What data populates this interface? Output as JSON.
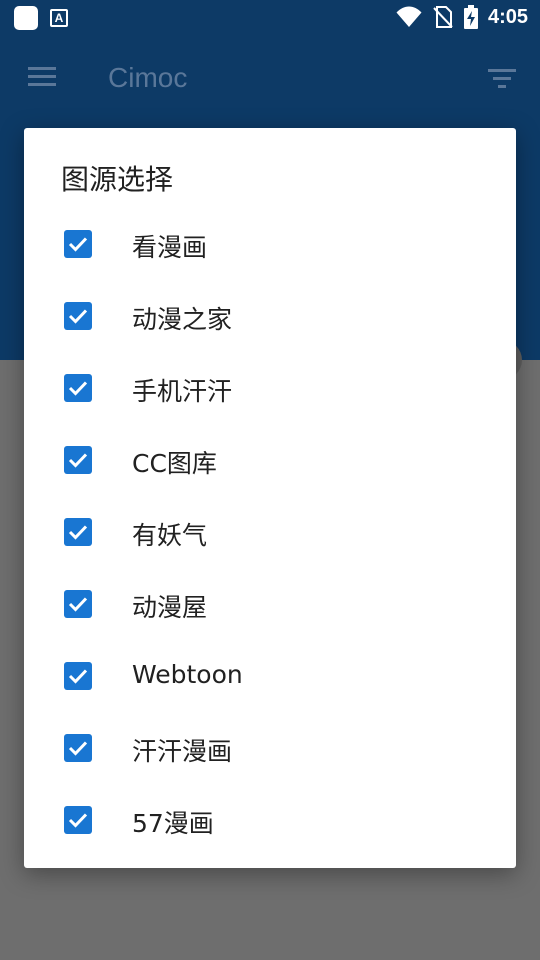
{
  "status_bar": {
    "time": "4:05",
    "notification_icons": [
      "app-square-icon",
      "text-a-icon"
    ],
    "system_icons": [
      "wifi-icon",
      "no-sim-icon",
      "battery-charging-icon"
    ]
  },
  "app_bar": {
    "title": "Cimoc",
    "menu_icon": "menu-icon",
    "filter_icon": "filter-icon"
  },
  "dialog": {
    "title": "图源选择",
    "options": [
      {
        "label": "看漫画",
        "checked": true
      },
      {
        "label": "动漫之家",
        "checked": true
      },
      {
        "label": "手机汗汗",
        "checked": true
      },
      {
        "label": "CC图库",
        "checked": true
      },
      {
        "label": "有妖气",
        "checked": true
      },
      {
        "label": "动漫屋",
        "checked": true
      },
      {
        "label": "Webtoon",
        "checked": true
      },
      {
        "label": "汗汗漫画",
        "checked": true
      },
      {
        "label": "57漫画",
        "checked": true
      }
    ]
  },
  "colors": {
    "primary_dark": "#0d3a66",
    "accent_checkbox": "#1976d2",
    "scrim": "#6e6e6e",
    "dialog_bg": "#ffffff"
  }
}
